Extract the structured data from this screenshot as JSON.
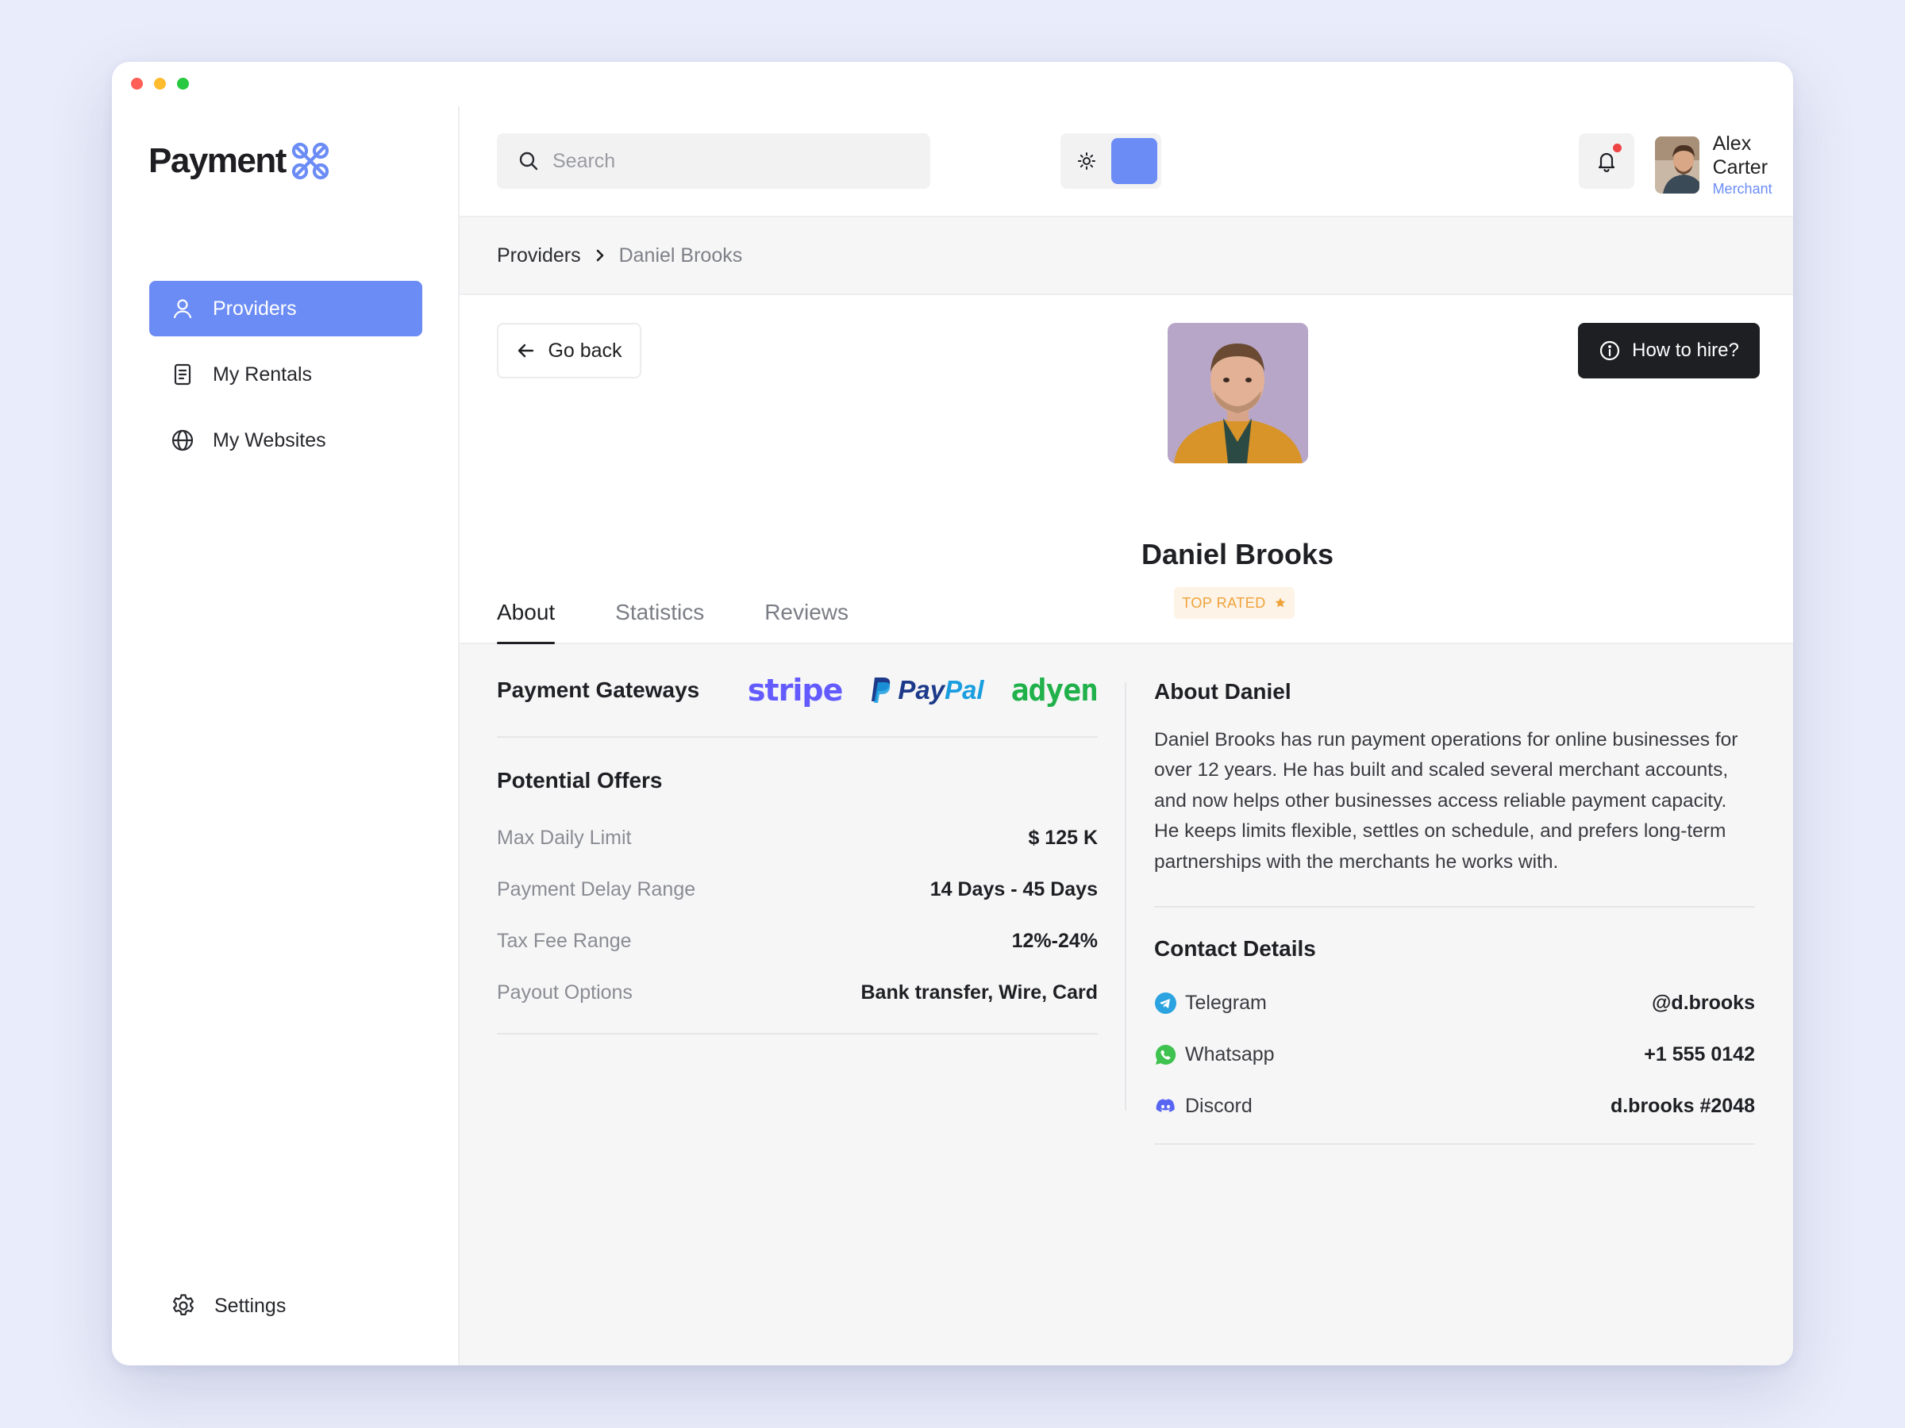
{
  "brand": {
    "name": "Payment",
    "accent": "#6b8cf5"
  },
  "sidebar": {
    "items": [
      {
        "label": "Providers",
        "icon": "user-icon",
        "active": true
      },
      {
        "label": "My Rentals",
        "icon": "document-icon",
        "active": false
      },
      {
        "label": "My Websites",
        "icon": "globe-icon",
        "active": false
      }
    ],
    "settings_label": "Settings"
  },
  "topbar": {
    "search_placeholder": "Search",
    "user": {
      "name": "Alex Carter",
      "role": "Merchant"
    }
  },
  "breadcrumb": {
    "parent": "Providers",
    "current": "Daniel Brooks"
  },
  "profile": {
    "back_label": "Go back",
    "hire_label": "How to hire?",
    "name": "Daniel Brooks",
    "badge": "TOP RATED",
    "tabs": [
      "About",
      "Statistics",
      "Reviews"
    ],
    "active_tab": "About"
  },
  "gateways": {
    "title": "Payment Gateways",
    "logos": {
      "stripe": "stripe",
      "paypal_a": "Pay",
      "paypal_b": "Pal",
      "adyen": "adyen"
    }
  },
  "offers": {
    "title": "Potential Offers",
    "rows": [
      {
        "label": "Max Daily Limit",
        "value": "$ 125 K"
      },
      {
        "label": "Payment Delay Range",
        "value": "14 Days - 45 Days"
      },
      {
        "label": "Tax Fee Range",
        "value": "12%-24%"
      },
      {
        "label": "Payout Options",
        "value": "Bank transfer, Wire, Card"
      }
    ]
  },
  "about": {
    "title": "About Daniel",
    "text": "Daniel Brooks has run payment operations for online businesses for over 12 years. He has built and scaled several merchant accounts, and now helps other businesses access reliable payment capacity. He keeps limits flexible, settles on schedule, and prefers long-term partnerships with the merchants he works with."
  },
  "contacts": {
    "title": "Contact Details",
    "rows": [
      {
        "label": "Telegram",
        "value": "@d.brooks",
        "icon": "telegram-icon",
        "color": "#2aa3e0"
      },
      {
        "label": "Whatsapp",
        "value": "+1 555 0142",
        "icon": "whatsapp-icon",
        "color": "#3fc24f"
      },
      {
        "label": "Discord",
        "value": "d.brooks #2048",
        "icon": "discord-icon",
        "color": "#5865f2"
      }
    ]
  }
}
